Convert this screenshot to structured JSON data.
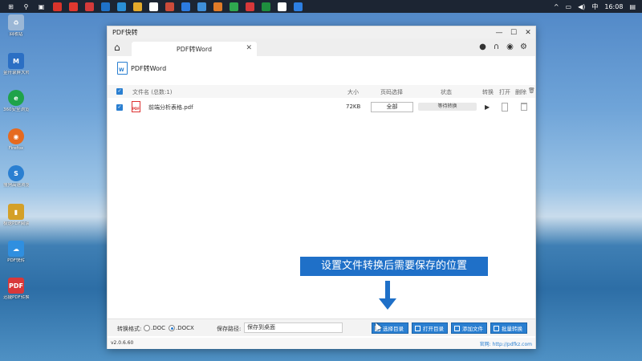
{
  "taskbar": {
    "tray": {
      "arrow": "^",
      "input_mode": "中",
      "time": "16:08"
    },
    "app_colors": [
      "#d9342b",
      "#e0382f",
      "#d43a3a",
      "#1f72c9",
      "#2a8fd6",
      "#e4aa2b",
      "#ffffff",
      "#cc4b3a",
      "#2c7be0",
      "#3f8fd8",
      "#e07b28",
      "#2fa84f",
      "#d8383a",
      "#1e8e3e",
      "#ffffff",
      "#2d7fe2"
    ]
  },
  "desktop": [
    {
      "label": "回收站",
      "icon": "recycle-bin-icon",
      "color": "#9bb7d6"
    },
    {
      "label": "金舟录屏大师",
      "icon": "recorder-icon",
      "color": "#2b6fc4"
    },
    {
      "label": "360安全浏览器",
      "icon": "browser-icon",
      "color": "#1fa34a"
    },
    {
      "label": "Firefox",
      "icon": "firefox-icon",
      "color": "#e66a1f"
    },
    {
      "label": "搜狗高速浏览器",
      "icon": "sogou-icon",
      "color": "#2a7fd1"
    },
    {
      "label": "极速PDF阅读",
      "icon": "pdf-reader-icon",
      "color": "#d4a028"
    },
    {
      "label": "PDF快转",
      "icon": "cloud-pdf-icon",
      "color": "#2f8fe0"
    },
    {
      "label": "迅捷PDF转换器",
      "icon": "pdf-converter-icon",
      "color": "#d8383a"
    }
  ],
  "window": {
    "title": "PDF快转",
    "controls": {
      "min": "—",
      "max": "☐",
      "close": "✕"
    },
    "tab": {
      "label": "PDF转Word",
      "close": "✕"
    },
    "subhead": "PDF转Word",
    "doc_icon_letter": "W",
    "table": {
      "headers": {
        "name": "文件名 (总数:1)",
        "size": "大小",
        "pages": "页码选择",
        "status": "状态",
        "convert": "转换",
        "open": "打开",
        "delete": "删除"
      },
      "rows": [
        {
          "name": "前端分析表格.pdf",
          "size": "72KB",
          "pages": "全部",
          "status": "等待转换"
        }
      ]
    },
    "bottom": {
      "format_label": "转换格式:",
      "options": [
        ".DOC",
        ".DOCX"
      ],
      "selected": ".DOCX",
      "path_label": "保存路径:",
      "path_value": "保存到桌面",
      "buttons": {
        "choose": "选择目录",
        "open": "打开目录",
        "add": "添加文件",
        "batch": "批量转换"
      }
    },
    "version": "v2.0.6.60",
    "website": "官网: http://pdfkz.com"
  },
  "annotation": {
    "callout": "设置文件转换后需要保存的位置",
    "color": "#1f70c8"
  }
}
